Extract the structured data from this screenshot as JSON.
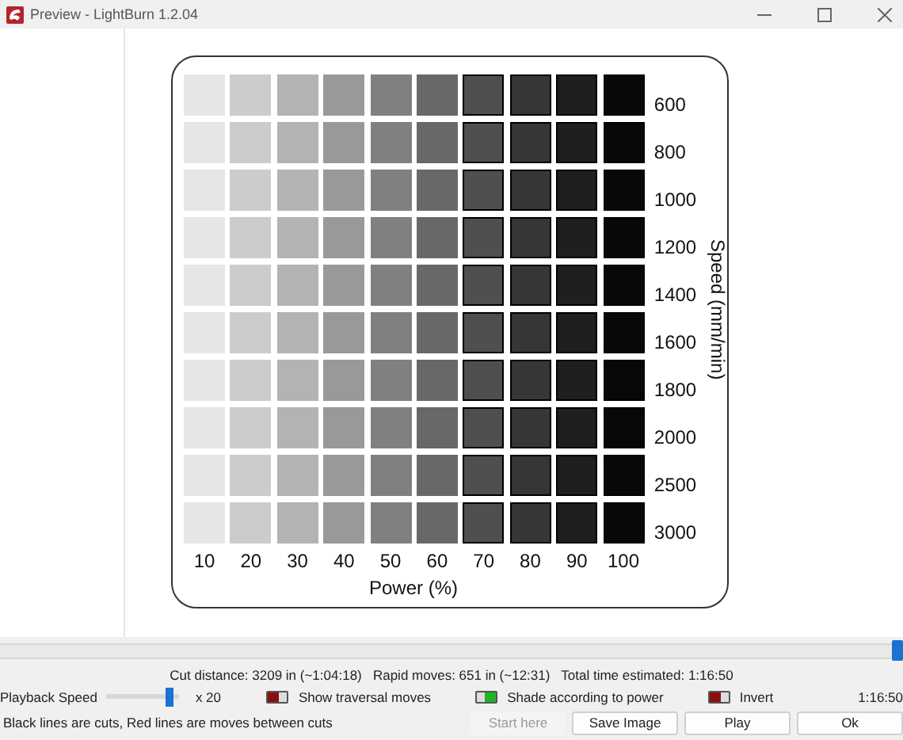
{
  "window": {
    "title": "Preview - LightBurn 1.2.04"
  },
  "test_grid": {
    "speed_title": "Speed (mm/min)",
    "power_title": "Power (%)",
    "speeds": [
      "600",
      "800",
      "1000",
      "1200",
      "1400",
      "1600",
      "1800",
      "2000",
      "2500",
      "3000"
    ],
    "powers": [
      {
        "label": "10",
        "color": "#e6e6e6"
      },
      {
        "label": "20",
        "color": "#cccccc"
      },
      {
        "label": "30",
        "color": "#b3b3b3"
      },
      {
        "label": "40",
        "color": "#999999"
      },
      {
        "label": "50",
        "color": "#808080"
      },
      {
        "label": "60",
        "color": "#686868"
      },
      {
        "label": "70",
        "color": "#4f4f4f"
      },
      {
        "label": "80",
        "color": "#363636"
      },
      {
        "label": "90",
        "color": "#1f1f1f"
      },
      {
        "label": "100",
        "color": "#080808"
      }
    ]
  },
  "timeline": {
    "level": 1.0
  },
  "stats": "Cut distance: 3209 in (~1:04:18)   Rapid moves: 651 in (~12:31)   Total time estimated: 1:16:50",
  "playback": {
    "label": "Playback Speed",
    "level": 0.85,
    "reading": "x 20"
  },
  "toggles": [
    {
      "label": "Show traversal moves",
      "on": false
    },
    {
      "label": "Shade according to power",
      "on": true
    },
    {
      "label": "Invert",
      "on": false
    }
  ],
  "elapsed": "1:16:50",
  "hint": "Black lines are cuts, Red lines are moves between cuts",
  "buttons": [
    {
      "label": "Start here",
      "disabled": true
    },
    {
      "label": "Save Image",
      "disabled": false
    },
    {
      "label": "Play",
      "disabled": false
    },
    {
      "label": "Ok",
      "disabled": false
    }
  ]
}
